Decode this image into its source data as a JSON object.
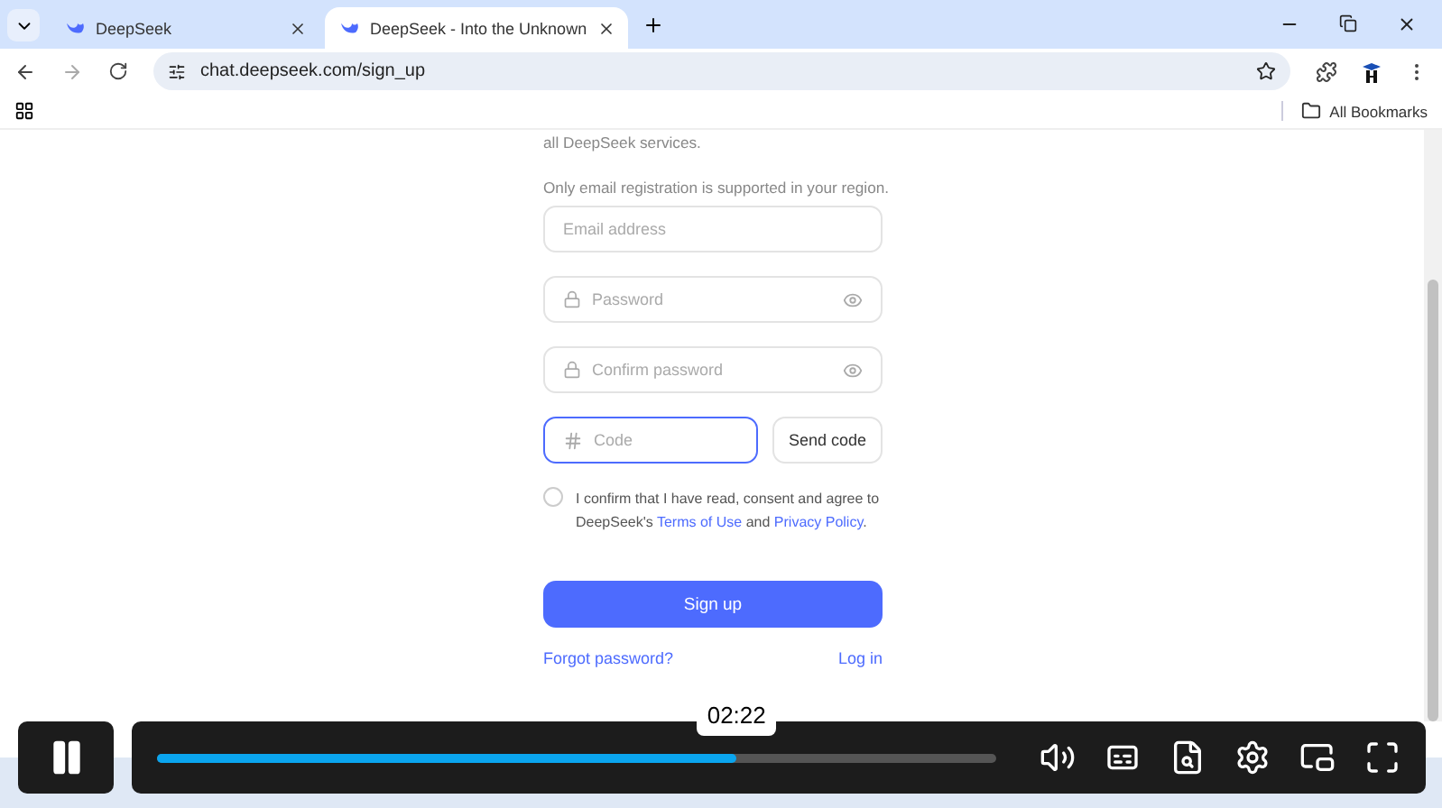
{
  "browser": {
    "tabs": [
      {
        "title": "DeepSeek",
        "selected": false
      },
      {
        "title": "DeepSeek - Into the Unknown",
        "selected": true
      }
    ],
    "url": "chat.deepseek.com/sign_up",
    "bookmarks": "All Bookmarks"
  },
  "form": {
    "intro": "all DeepSeek services.",
    "notice": "Only email registration is supported in your region.",
    "fields": [
      {
        "kind": "plain",
        "placeholder": "Email address",
        "focused": false
      },
      {
        "kind": "password",
        "placeholder": "Password",
        "focused": false
      },
      {
        "kind": "password",
        "placeholder": "Confirm password",
        "focused": false
      },
      {
        "kind": "code",
        "placeholder": "Code",
        "focused": true
      }
    ],
    "send_code": "Send code",
    "consent": {
      "checked": false,
      "before": "I confirm that I have read, consent and agree to DeepSeek's",
      "terms": "Terms of Use",
      "and": "and",
      "privacy": "Privacy Policy",
      "after": "."
    },
    "submit": "Sign up",
    "forgot": "Forgot password?",
    "login": "Log in"
  },
  "player": {
    "time": "02:22",
    "progress": {
      "level": 0.69
    }
  }
}
